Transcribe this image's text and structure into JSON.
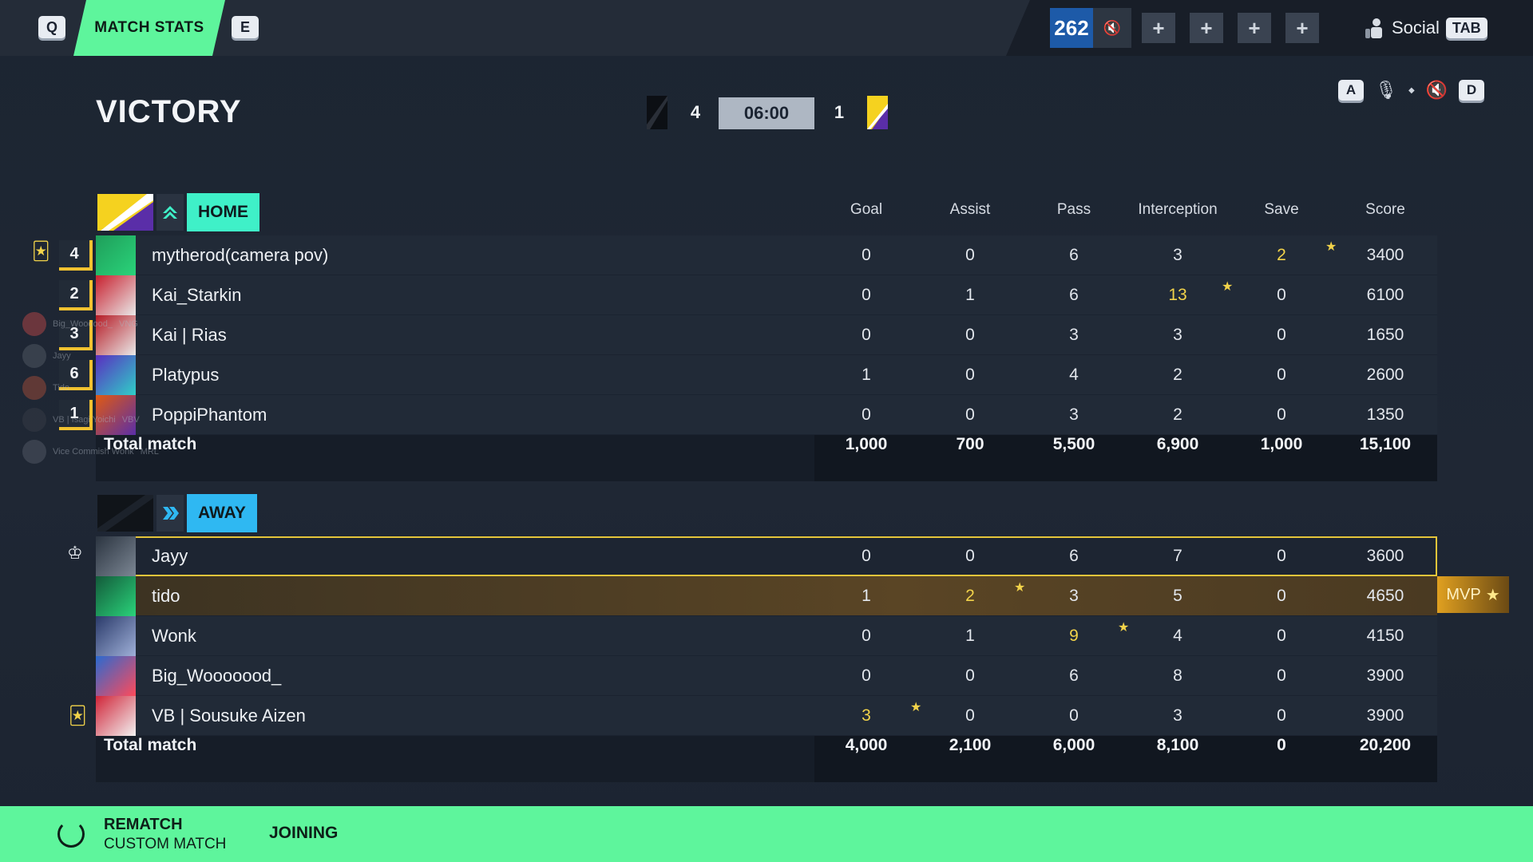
{
  "topbar": {
    "key_left": "Q",
    "active_tab": "MATCH STATS",
    "key_right": "E",
    "party_count": "262",
    "social_label": "Social",
    "social_key": "TAB",
    "slot_symbol": "+"
  },
  "header": {
    "result": "VICTORY",
    "home_score": "4",
    "timer": "06:00",
    "away_score": "1",
    "voice_key_left": "A",
    "voice_key_right": "D"
  },
  "columns": [
    "Goal",
    "Assist",
    "Pass",
    "Interception",
    "Save",
    "Score"
  ],
  "home": {
    "label": "HOME",
    "players": [
      {
        "rank": "4",
        "name": "mytherod(camera pov)",
        "stats": [
          "0",
          "0",
          "6",
          "3",
          "2",
          "3400"
        ],
        "highlight": 4
      },
      {
        "rank": "2",
        "name": "Kai_Starkin",
        "stats": [
          "0",
          "1",
          "6",
          "13",
          "0",
          "6100"
        ],
        "highlight": 3
      },
      {
        "rank": "3",
        "name": "Kai | Rias",
        "stats": [
          "0",
          "0",
          "3",
          "3",
          "0",
          "1650"
        ],
        "highlight": -1
      },
      {
        "rank": "6",
        "name": "Platypus",
        "stats": [
          "1",
          "0",
          "4",
          "2",
          "0",
          "2600"
        ],
        "highlight": -1
      },
      {
        "rank": "1",
        "name": "PoppiPhantom",
        "stats": [
          "0",
          "0",
          "3",
          "2",
          "0",
          "1350"
        ],
        "highlight": -1
      }
    ],
    "total_label": "Total match",
    "totals": [
      "1,000",
      "700",
      "5,500",
      "6,900",
      "1,000",
      "15,100"
    ]
  },
  "away": {
    "label": "AWAY",
    "players": [
      {
        "name": "Jayy",
        "stats": [
          "0",
          "0",
          "6",
          "7",
          "0",
          "3600"
        ],
        "highlight": -1
      },
      {
        "name": "tido",
        "stats": [
          "1",
          "2",
          "3",
          "5",
          "0",
          "4650"
        ],
        "highlight": 1
      },
      {
        "name": "Wonk",
        "stats": [
          "0",
          "1",
          "9",
          "4",
          "0",
          "4150"
        ],
        "highlight": 2
      },
      {
        "name": "Big_Wooooood_",
        "stats": [
          "0",
          "0",
          "6",
          "8",
          "0",
          "3900"
        ],
        "highlight": -1
      },
      {
        "name": "VB | Sousuke Aizen",
        "stats": [
          "3",
          "0",
          "0",
          "3",
          "0",
          "3900"
        ],
        "highlight": 0
      }
    ],
    "total_label": "Total match",
    "totals": [
      "4,000",
      "2,100",
      "6,000",
      "8,100",
      "0",
      "20,200"
    ]
  },
  "mvp_label": "MVP",
  "overlay": {
    "items": [
      "Big_Woooood_",
      "VNG",
      "Jayy",
      "Tido",
      "VB | Isagi Yoichi",
      "VBV",
      "Vice Commish Wonk",
      "MRL"
    ]
  },
  "footer": {
    "rematch": "REMATCH",
    "mode": "CUSTOM MATCH",
    "status": "JOINING"
  },
  "colors": {
    "accent": "#5ef59c",
    "home": "#3ff0c8",
    "away": "#2fb8f2",
    "highlight": "#f2d34a"
  }
}
